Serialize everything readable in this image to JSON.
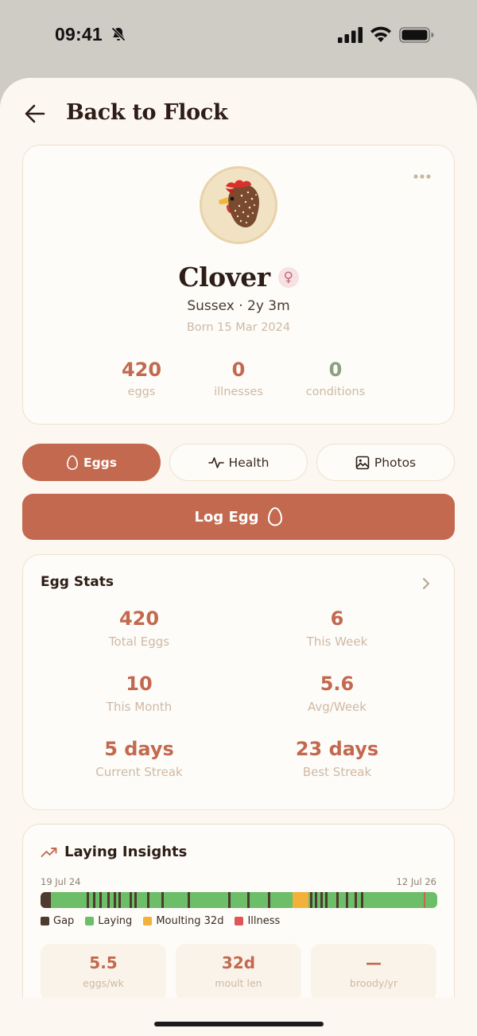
{
  "status_bar": {
    "time": "09:41"
  },
  "header": {
    "back_label": "Back to Flock"
  },
  "profile": {
    "name": "Clover",
    "sex_symbol": "♀",
    "breed_age": "Sussex · 2y 3m",
    "born": "Born 15 Mar 2024",
    "stats": [
      {
        "value": "420",
        "label": "eggs",
        "color": "#c2694f"
      },
      {
        "value": "0",
        "label": "illnesses",
        "color": "#c2694f"
      },
      {
        "value": "0",
        "label": "conditions",
        "color": "#8aa17c"
      }
    ]
  },
  "tabs": [
    {
      "label": "Eggs",
      "icon": "egg-icon",
      "active": true
    },
    {
      "label": "Health",
      "icon": "pulse-icon",
      "active": false
    },
    {
      "label": "Photos",
      "icon": "image-icon",
      "active": false
    }
  ],
  "log_button": {
    "label": "Log Egg"
  },
  "egg_stats": {
    "title": "Egg Stats",
    "items": [
      {
        "value": "420",
        "label": "Total Eggs"
      },
      {
        "value": "6",
        "label": "This Week"
      },
      {
        "value": "10",
        "label": "This Month"
      },
      {
        "value": "5.6",
        "label": "Avg/Week"
      },
      {
        "value": "5 days",
        "label": "Current Streak"
      },
      {
        "value": "23 days",
        "label": "Best Streak"
      }
    ]
  },
  "insights": {
    "title": "Laying Insights",
    "date_start": "19 Jul 24",
    "date_end": "12 Jul 26",
    "legend": [
      {
        "label": "Gap",
        "color": "#4e3a2e"
      },
      {
        "label": "Laying",
        "color": "#6cbf68"
      },
      {
        "label": "Moulting 32d",
        "color": "#f1b13b"
      },
      {
        "label": "Illness",
        "color": "#e0545a"
      }
    ],
    "tiles": [
      {
        "value": "5.5",
        "label": "eggs/wk"
      },
      {
        "value": "32d",
        "label": "moult len"
      },
      {
        "value": "—",
        "label": "broody/yr"
      }
    ]
  },
  "colors": {
    "accent": "#c2694f",
    "background": "#fdf7f1",
    "card_border": "#ede2cf"
  }
}
